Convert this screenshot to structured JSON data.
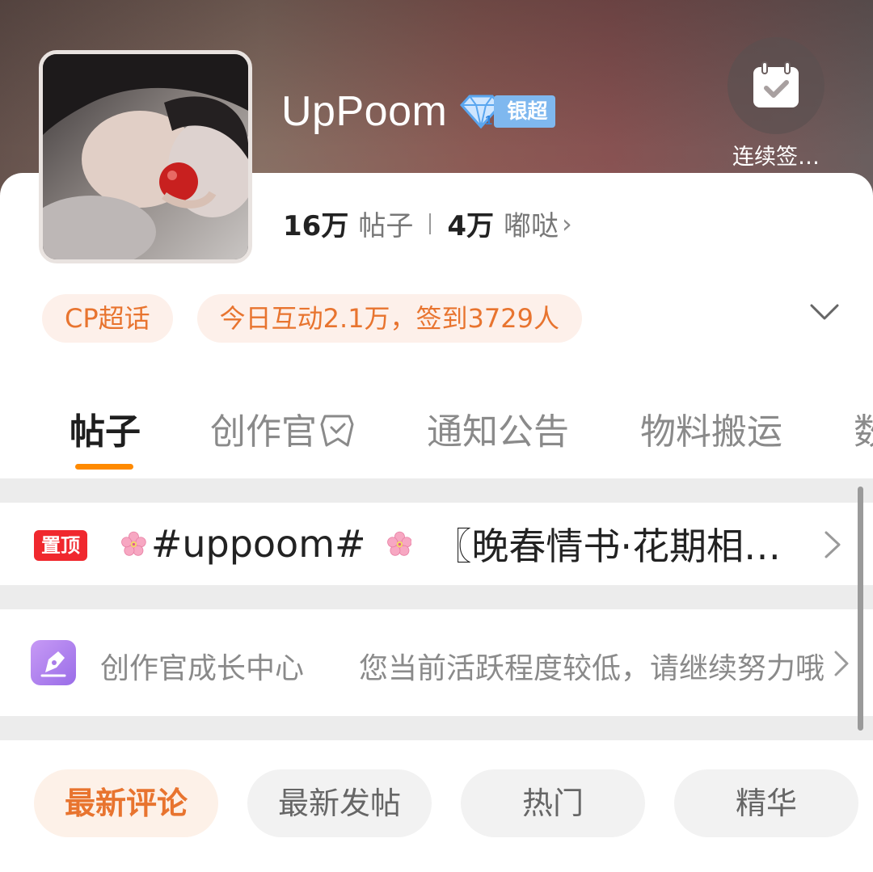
{
  "header": {
    "name": "UpPoom",
    "badge_label": "银超",
    "checkin_label": "连续签…",
    "stats": {
      "posts_count": "16万",
      "posts_label": "帖子",
      "dudu_count": "4万",
      "dudu_label": "嘟哒"
    },
    "chips": [
      "CP超话",
      "今日互动2.1万，签到3729人"
    ]
  },
  "tabs": [
    {
      "label": "帖子",
      "active": true
    },
    {
      "label": "创作官",
      "active": false
    },
    {
      "label": "通知公告",
      "active": false
    },
    {
      "label": "物料搬运",
      "active": false
    },
    {
      "label": "数",
      "active": false
    }
  ],
  "pinned": {
    "badge": "置顶",
    "text_a": "#uppoom#",
    "text_b": "〖晚春情书·花期相…"
  },
  "creator": {
    "title": "创作官成长中心",
    "subtitle": "您当前活跃程度较低，请继续努力哦"
  },
  "filters": [
    {
      "label": "最新评论",
      "active": true
    },
    {
      "label": "最新发帖",
      "active": false
    },
    {
      "label": "热门",
      "active": false
    },
    {
      "label": "精华",
      "active": false
    }
  ],
  "colors": {
    "accent": "#ff8a00",
    "chip_text": "#e8742f",
    "pin_red": "#f0282e",
    "badge_blue": "#7fb8ef"
  }
}
